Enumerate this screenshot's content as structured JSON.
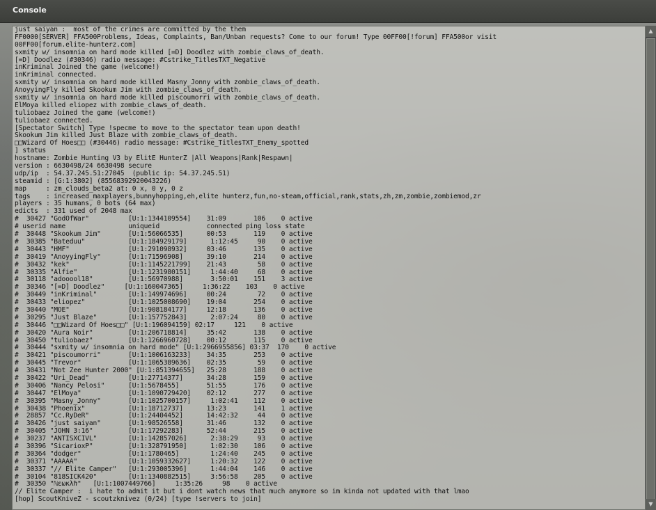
{
  "window": {
    "title": "Console"
  },
  "scrollbar": {
    "up_glyph": "▲",
    "down_glyph": "▼"
  },
  "console": {
    "lines": [
      "just saiyan :  most of the crimes are committed by the them",
      "FF0000[SERVER] FFA500Problems, Ideas, Complaints, Ban/Unban requests? Come to our forum! Type 00FF00[!forum] FFA500or visit",
      "00FF00[forum.elite-hunterz.com]",
      "sxmity w/ insomnia on hard mode killed [=D] Doodlez with zombie_claws_of_death.",
      "[=D] Doodlez (#30346) radio message: #Cstrike_TitlesTXT_Negative",
      "inKriminal Joined the game (welcome!)",
      "inKriminal connected.",
      "sxmity w/ insomnia on hard mode killed Masny_Jonny with zombie_claws_of_death.",
      "AnoyyingFly killed Skookum Jim with zombie_claws_of_death.",
      "sxmity w/ insomnia on hard mode killed piscoumorri with zombie_claws_of_death.",
      "ElMoya killed eliopez with zombie_claws_of_death.",
      "tuliobaez Joined the game (welcome!)",
      "tuliobaez connected.",
      "[Spectator Switch] Type !specme to move to the spectator team upon death!",
      "Skookum Jim killed Just Blaze with zombie_claws_of_death.",
      "□□Wizard Of Hoes□□ (#30446) radio message: #Cstrike_TitlesTXT_Enemy_spotted",
      "] status",
      "hostname: Zombie Hunting V3 by ElitE HunterZ |All Weapons|Rank|Respawn|",
      "version : 6630498/24 6630498 secure",
      "udp/ip  : 54.37.245.51:27045  (public ip: 54.37.245.51)",
      "steamid : [G:1:3802] (85568392920043226)",
      "map     : zm_clouds_beta2 at: 0 x, 0 y, 0 z",
      "tags    : increased_maxplayers,bunnyhopping,eh,elite hunterz,fun,no-steam,official,rank,stats,zh,zm,zombie,zombiemod,zr",
      "players : 35 humans, 0 bots (64 max)",
      "edicts  : 331 used of 2048 max",
      "#  30427 \"GodOfWar\"          [U:1:1344109554]    31:09       106    0 active",
      "# userid name                uniqueid            connected ping loss state",
      "#  30448 \"Skookum Jim\"       [U:1:56066535]      00:53       119    0 active",
      "#  30385 \"Bateduu\"           [U:1:184929179]      1:12:45     90    0 active",
      "#  30443 \"HMF\"               [U:1:291098932]     03:46       135    0 active",
      "#  30419 \"AnoyyingFly\"       [U:1:71596908]      39:10       214    0 active",
      "#  30432 \"kek\"               [U:1:1145221799]    21:43        58    0 active",
      "#  30335 \"Alfie\"             [U:1:1231980151]     1:44:40     68    0 active",
      "#  30118 \"adooool18\"         [U:1:56970988]       3:50:01    151    3 active",
      "#  30346 \"[=D] Doodlez\"     [U:1:160047365]     1:36:22    103    0 active",
      "#  30449 \"inKriminal\"        [U:1:149974696]     00:24        72    0 active",
      "#  30433 \"eliopez\"           [U:1:1025008690]    19:04       254    0 active",
      "#  30440 \"MOE\"               [U:1:908184177]     12:18       136    0 active",
      "#  30295 \"Just Blaze\"        [U:1:157752843]      2:07:24     80    0 active",
      "#  30446 \"□□Wizard Of Hoes□□\" [U:1:196094159] 02:17     121    0 active",
      "#  30420 \"Aura Noir\"         [U:1:206718814]     35:42       138    0 active",
      "#  30450 \"tuliobaez\"         [U:1:1266960728]    00:12       115    0 active",
      "#  30444 \"sxmity w/ insomnia on hard mode\" [U:1:2966955856] 03:37  170    0 active",
      "#  30421 \"piscoumorri\"       [U:1:1006163233]    34:35       253    0 active",
      "#  30445 \"Trevor\"            [U:1:1065389636]    02:35        59    0 active",
      "#  30431 \"Not Zee Hunter 2000\" [U:1:851394655]   25:28       188    0 active",
      "#  30422 \"Uri_Dead\"          [U:1:27714377]      34:28       159    0 active",
      "#  30406 \"Nancy Pelosi\"      [U:1:5678455]       51:55       176    0 active",
      "#  30447 \"ElMoya\"            [U:1:1090729420]    02:12       277    0 active",
      "#  30395 \"Masny_Jonny\"       [U:1:1025700157]     1:02:41    112    0 active",
      "#  30438 \"Phoenix\"           [U:1:18712737]      13:23       141    1 active",
      "#  28857 \"Cc.RyDeR\"          [U:1:24404452]      14:42:32     44    0 active",
      "#  30426 \"just saiyan\"       [U:1:98526558]      31:46       132    0 active",
      "#  30405 \"JOHN 3:16\"         [U:1:17292283]      52:44       215    0 active",
      "#  30237 \"ANTISXCIVL\"        [U:1:142857026]      2:38:29     93    0 active",
      "#  30396 \"SicarioxP\"         [U:1:328791950]      1:02:30    106    0 active",
      "#  30364 \"dodger\"            [U:1:1780465]        1:24:40    245    0 active",
      "#  30371 \"AAAAA\"             [U:1:1059332627]     1:20:32    122    0 active",
      "#  30337 \"// Elite Camper\"   [U:1:293005396]      1:44:04    146    0 active",
      "#  30104 \"818SICK420\"        [U:1:1340882515]     3:56:58    205    0 active",
      "#  30350 \"ℕεωкλℏ\"   [U:1:1007449766]     1:35:26     98    0 active",
      "// Elite Camper :  i hate to admit it but i dont watch news that much anymore so im kinda not updated with that lmao",
      "[hop] ScoutKniveZ - scoutzknivez (0/24) [type !servers to join]"
    ]
  }
}
